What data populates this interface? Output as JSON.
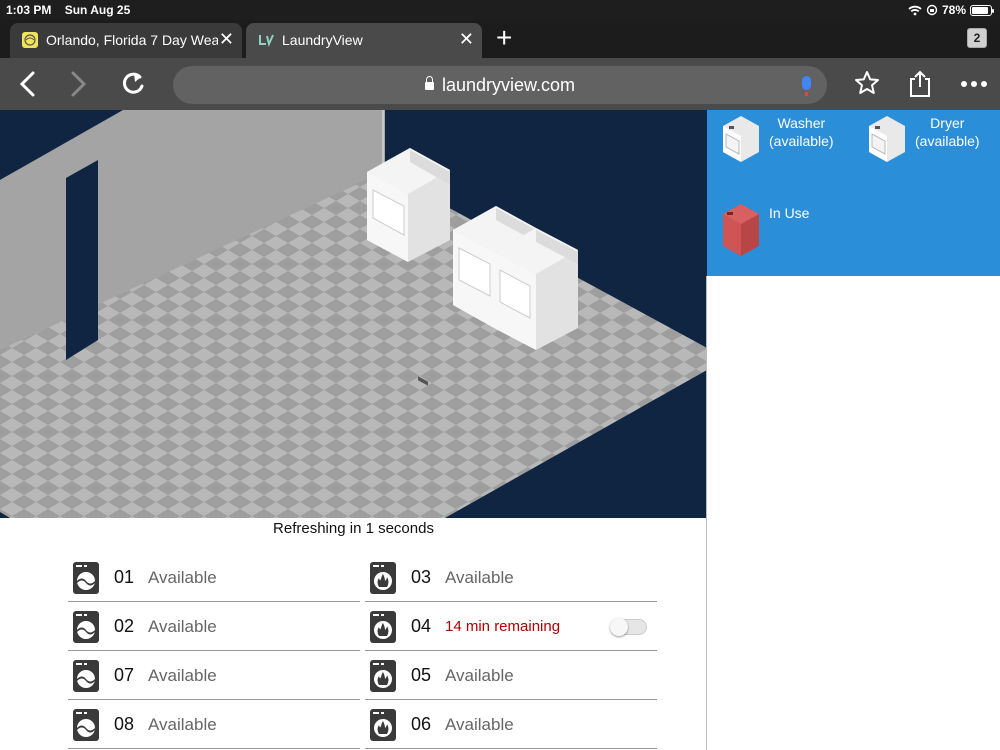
{
  "status_bar": {
    "time": "1:03 PM",
    "date": "Sun Aug 25",
    "battery": "78%"
  },
  "tabs": [
    {
      "title": "Orlando, Florida 7 Day Weat",
      "active": false
    },
    {
      "title": "LaundryView",
      "active": true
    }
  ],
  "tab_count": "2",
  "url": "laundryview.com",
  "legend": {
    "washer_label": "Washer",
    "washer_status": "(available)",
    "dryer_label": "Dryer",
    "dryer_status": "(available)",
    "in_use_label": "In Use"
  },
  "refresh_text": "Refreshing in 1 seconds",
  "machines_left": [
    {
      "number": "01",
      "status": "Available",
      "type": "washer"
    },
    {
      "number": "02",
      "status": "Available",
      "type": "washer"
    },
    {
      "number": "07",
      "status": "Available",
      "type": "washer"
    },
    {
      "number": "08",
      "status": "Available",
      "type": "washer"
    }
  ],
  "machines_right": [
    {
      "number": "03",
      "status": "Available",
      "type": "dryer"
    },
    {
      "number": "04",
      "status": "14 min remaining",
      "type": "dryer",
      "in_use": true
    },
    {
      "number": "05",
      "status": "Available",
      "type": "dryer"
    },
    {
      "number": "06",
      "status": "Available",
      "type": "dryer"
    }
  ],
  "colors": {
    "legend_bg": "#2a8fd8",
    "in_use_red": "#b00000",
    "floor_dark": "#0f2542"
  }
}
